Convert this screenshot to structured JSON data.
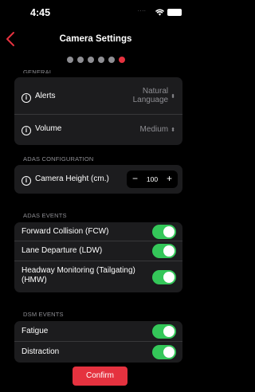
{
  "status_bar": {
    "time": "4:45",
    "signal": "....",
    "wifi_icon": "wifi-icon",
    "battery_icon": "battery-icon"
  },
  "nav": {
    "title": "Camera Settings",
    "back_icon": "chevron-left-icon"
  },
  "pager": {
    "total": 6,
    "active_index": 5,
    "dot_color": "#8e8e93",
    "active_color": "#e5323f"
  },
  "general": {
    "header": "GENERAL",
    "rows": [
      {
        "label": "Alerts",
        "value_line1": "Natural",
        "value_line2": "Language"
      },
      {
        "label": "Volume",
        "value": "Medium"
      }
    ]
  },
  "adas_configuration": {
    "header": "ADAS CONFIGURATION",
    "camera_height": {
      "label": "Camera Height (cm.)",
      "minus": "−",
      "value": "100",
      "plus": "+"
    }
  },
  "adas_events": {
    "header": "ADAS EVENTS",
    "items": [
      {
        "label": "Forward Collision (FCW)",
        "on": true
      },
      {
        "label": "Lane Departure (LDW)",
        "on": true
      },
      {
        "label_line1": "Headway Monitoring (Tailgating)",
        "label_line2": "(HMW)",
        "on": true
      }
    ]
  },
  "dsm_events": {
    "header": "DSM EVENTS",
    "items": [
      {
        "label": "Fatigue",
        "on": true
      },
      {
        "label": "Distraction",
        "on": true
      }
    ]
  },
  "confirm_label": "Confirm",
  "colors": {
    "accent": "#e5323f",
    "toggle_on": "#34c759",
    "cell_bg": "#1c1c1e"
  }
}
